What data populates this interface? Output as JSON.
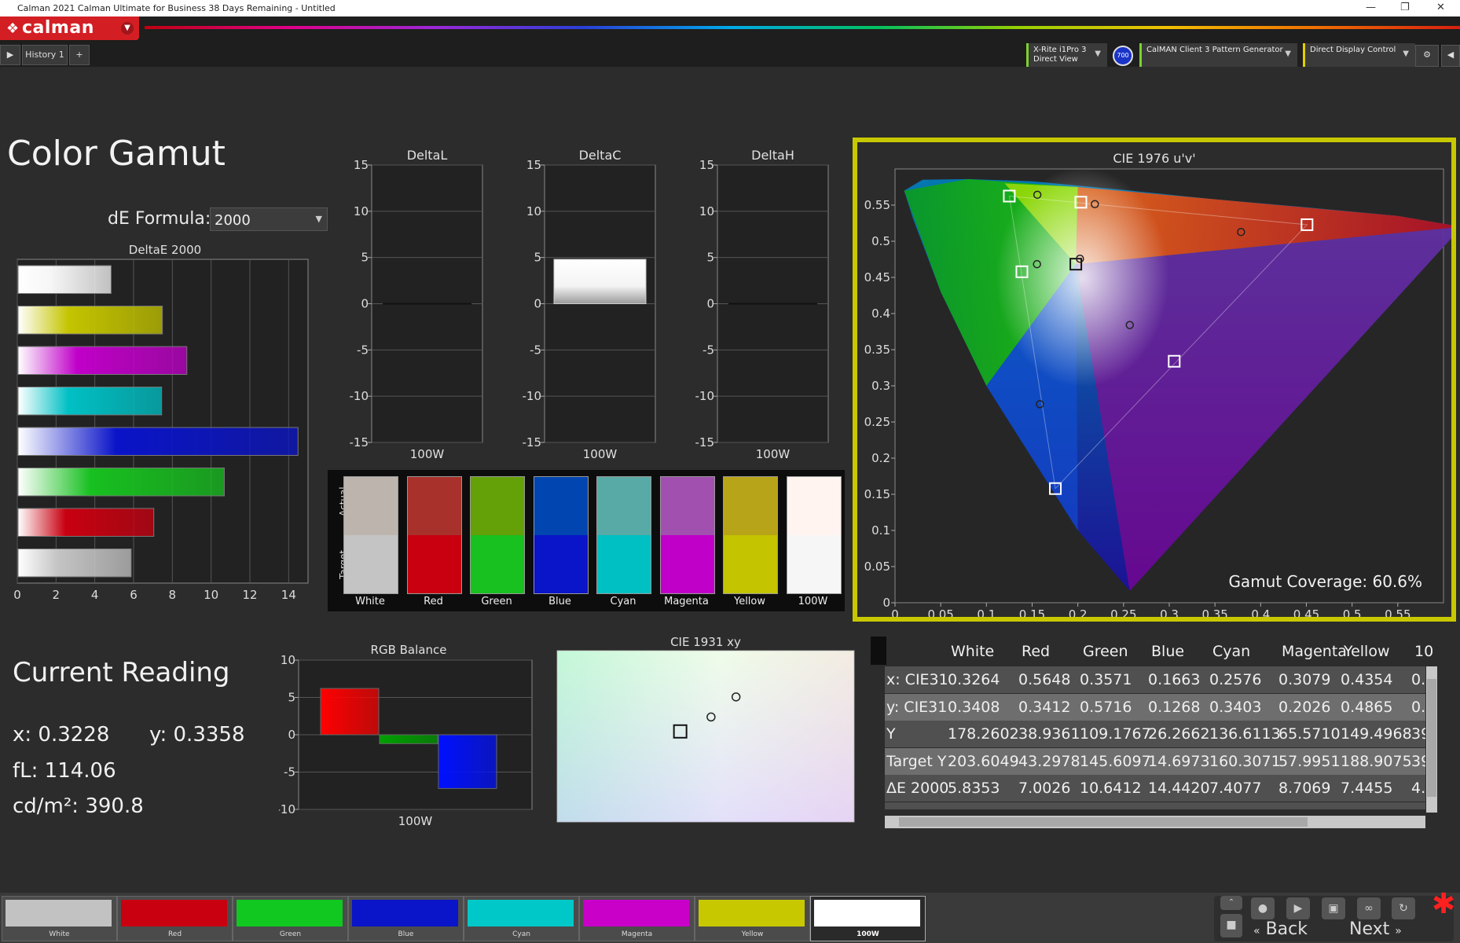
{
  "window": {
    "title": "Calman 2021 Calman Ultimate for Business 38 Days Remaining  - Untitled"
  },
  "toolbar": {
    "logo": "calman",
    "history_tab": "History 1",
    "devices": [
      {
        "line1": "X-Rite i1Pro 3",
        "line2": "Direct View"
      },
      {
        "line1": "CalMAN Client 3 Pattern Generator",
        "line2": ""
      },
      {
        "line1": "Direct Display Control",
        "line2": ""
      }
    ],
    "badge": "700"
  },
  "page": {
    "title": "Color Gamut",
    "de_formula_label": "dE Formula:",
    "de_formula_value": "2000",
    "current_reading_title": "Current Reading",
    "reading": {
      "x": "x: 0.3228",
      "y": "y: 0.3358",
      "fl": "fL: 114.06",
      "cdm2": "cd/m²: 390.8"
    },
    "gamut_coverage": "Gamut Coverage:  60.6%"
  },
  "colors": {
    "panel_highlight": "#c8c800",
    "bg": "#2c2c2c",
    "brand": "#d31e24"
  },
  "chart_data": [
    {
      "type": "bar",
      "title": "DeltaE 2000",
      "orientation": "horizontal",
      "categories": [
        "100W",
        "Yellow",
        "Magenta",
        "Cyan",
        "Blue",
        "Green",
        "Red",
        "White"
      ],
      "values": [
        4.8,
        7.4455,
        8.7069,
        7.4077,
        14.442,
        10.6412,
        7.0026,
        5.8353
      ],
      "xlim": [
        0,
        15
      ],
      "ticks": [
        "0",
        "2",
        "4",
        "6",
        "8",
        "10",
        "12",
        "14"
      ]
    },
    {
      "type": "bar",
      "title": "DeltaL",
      "categories": [
        "100W"
      ],
      "values": [
        0
      ],
      "ylim": [
        -15,
        15
      ],
      "ticks": [
        "15",
        "10",
        "5",
        "0",
        "-5",
        "-10",
        "-15"
      ]
    },
    {
      "type": "bar",
      "title": "DeltaC",
      "categories": [
        "100W"
      ],
      "values": [
        4.8
      ],
      "ylim": [
        -15,
        15
      ],
      "ticks": [
        "15",
        "10",
        "5",
        "0",
        "-5",
        "-10",
        "-15"
      ]
    },
    {
      "type": "bar",
      "title": "DeltaH",
      "categories": [
        "100W"
      ],
      "values": [
        0
      ],
      "ylim": [
        -15,
        15
      ],
      "ticks": [
        "15",
        "10",
        "5",
        "0",
        "-5",
        "-10",
        "-15"
      ]
    },
    {
      "type": "bar",
      "title": "RGB Balance",
      "categories": [
        "100W"
      ],
      "series": [
        {
          "name": "R",
          "values": [
            6.2
          ]
        },
        {
          "name": "G",
          "values": [
            -1.2
          ]
        },
        {
          "name": "B",
          "values": [
            -7.2
          ]
        }
      ],
      "ylim": [
        -10,
        10
      ],
      "ticks": [
        "10",
        "5",
        "0",
        "-5",
        "-10"
      ]
    },
    {
      "type": "scatter",
      "title": "CIE 1976 u'v'",
      "xlim": [
        0,
        0.6
      ],
      "ylim": [
        0,
        0.6
      ],
      "xticks": [
        "0",
        "0.05",
        "0.1",
        "0.15",
        "0.2",
        "0.25",
        "0.3",
        "0.35",
        "0.4",
        "0.45",
        "0.5",
        "0.55"
      ],
      "yticks": [
        "0",
        "0.05",
        "0.1",
        "0.15",
        "0.2",
        "0.25",
        "0.3",
        "0.35",
        "0.4",
        "0.45",
        "0.5",
        "0.55"
      ],
      "targets": [
        [
          0.4507,
          0.5229
        ],
        [
          0.125,
          0.5625
        ],
        [
          0.1754,
          0.1579
        ],
        [
          0.1978,
          0.4683
        ],
        [
          0.1388,
          0.4578
        ],
        [
          0.3054,
          0.334
        ],
        [
          0.2033,
          0.554
        ]
      ],
      "actuals": [
        [
          0.3785,
          0.5128
        ],
        [
          0.1557,
          0.5643
        ],
        [
          0.1585,
          0.2746
        ],
        [
          0.2023,
          0.4758
        ],
        [
          0.1553,
          0.4683
        ],
        [
          0.2568,
          0.3841
        ],
        [
          0.2186,
          0.5513
        ]
      ]
    },
    {
      "type": "scatter",
      "title": "CIE 1931 xy",
      "target": [
        0.3127,
        0.329
      ],
      "actuals": [
        [
          0.3264,
          0.3408
        ],
        [
          0.3375,
          0.3572
        ]
      ]
    }
  ],
  "swatches": {
    "row_actual": "Actual",
    "row_target": "Target",
    "items": [
      {
        "label": "White",
        "actual": "#bdb5ad",
        "target": "#c4c4c4"
      },
      {
        "label": "Red",
        "actual": "#a8322b",
        "target": "#c80010"
      },
      {
        "label": "Green",
        "actual": "#64a007",
        "target": "#18c020"
      },
      {
        "label": "Blue",
        "actual": "#0045b0",
        "target": "#0a14c8"
      },
      {
        "label": "Cyan",
        "actual": "#58aaa6",
        "target": "#00c0c4"
      },
      {
        "label": "Magenta",
        "actual": "#a150b0",
        "target": "#c000c8"
      },
      {
        "label": "Yellow",
        "actual": "#b8a418",
        "target": "#c4c400"
      },
      {
        "label": "100W",
        "actual": "#fff4f0",
        "target": "#f6f6f6"
      }
    ]
  },
  "table": {
    "columns": [
      "White",
      "Red",
      "Green",
      "Blue",
      "Cyan",
      "Magenta",
      "Yellow",
      "10"
    ],
    "rows": [
      {
        "name": "x: CIE31",
        "vals": [
          "0.3264",
          "0.5648",
          "0.3571",
          "0.1663",
          "0.2576",
          "0.3079",
          "0.4354",
          "0."
        ]
      },
      {
        "name": "y: CIE31",
        "vals": [
          "0.3408",
          "0.3412",
          "0.5716",
          "0.1268",
          "0.3403",
          "0.2026",
          "0.4865",
          "0."
        ]
      },
      {
        "name": "Y",
        "vals": [
          "178.2602",
          "38.9361",
          "109.1767",
          "26.2662",
          "136.6113",
          "65.5710",
          "149.4968",
          "39"
        ]
      },
      {
        "name": "Target Y",
        "vals": [
          "203.6049",
          "43.2978",
          "145.6097",
          "14.6973",
          "160.3071",
          "57.9951",
          "188.9075",
          "39"
        ]
      },
      {
        "name": "ΔE 2000",
        "vals": [
          "5.8353",
          "7.0026",
          "10.6412",
          "14.4420",
          "7.4077",
          "8.7069",
          "7.4455",
          "4."
        ]
      }
    ]
  },
  "bottom": {
    "swatches": [
      {
        "label": "White",
        "color": "#c2c2c2"
      },
      {
        "label": "Red",
        "color": "#c80010"
      },
      {
        "label": "Green",
        "color": "#10c820"
      },
      {
        "label": "Blue",
        "color": "#0a14c8"
      },
      {
        "label": "Cyan",
        "color": "#00c8c8"
      },
      {
        "label": "Magenta",
        "color": "#c800c8"
      },
      {
        "label": "Yellow",
        "color": "#c8c800"
      },
      {
        "label": "100W",
        "color": "#ffffff"
      }
    ],
    "back": "Back",
    "next": "Next"
  }
}
